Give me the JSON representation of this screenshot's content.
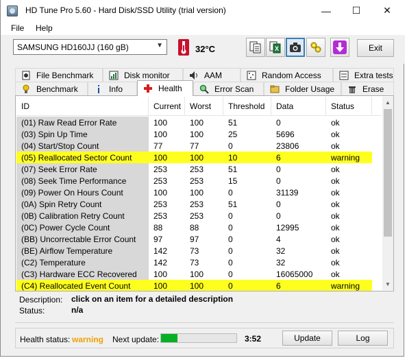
{
  "window": {
    "title": "HD Tune Pro 5.60 - Hard Disk/SSD Utility (trial version)",
    "minimize": "—",
    "maximize": "☐",
    "close": "✕"
  },
  "menu": {
    "file": "File",
    "help": "Help"
  },
  "toolbar": {
    "drive": "SAMSUNG HD160JJ (160 gB)",
    "temperature": "32°C",
    "exit_label": "Exit",
    "buttons": [
      "copy-text-icon",
      "copy-excel-icon",
      "screenshot-icon",
      "options-icon",
      "save-download-icon"
    ]
  },
  "tabs": {
    "row1": [
      "File Benchmark",
      "Disk monitor",
      "AAM",
      "Random Access",
      "Extra tests"
    ],
    "row2": [
      "Benchmark",
      "Info",
      "Health",
      "Error Scan",
      "Folder Usage",
      "Erase"
    ],
    "active": "Health"
  },
  "table": {
    "headers": [
      "ID",
      "Current",
      "Worst",
      "Threshold",
      "Data",
      "Status"
    ],
    "rows": [
      [
        "(01) Raw Read Error Rate",
        "100",
        "100",
        "51",
        "0",
        "ok"
      ],
      [
        "(03) Spin Up Time",
        "100",
        "100",
        "25",
        "5696",
        "ok"
      ],
      [
        "(04) Start/Stop Count",
        "77",
        "77",
        "0",
        "23806",
        "ok"
      ],
      [
        "(05) Reallocated Sector Count",
        "100",
        "100",
        "10",
        "6",
        "warning"
      ],
      [
        "(07) Seek Error Rate",
        "253",
        "253",
        "51",
        "0",
        "ok"
      ],
      [
        "(08) Seek Time Performance",
        "253",
        "253",
        "15",
        "0",
        "ok"
      ],
      [
        "(09) Power On Hours Count",
        "100",
        "100",
        "0",
        "31139",
        "ok"
      ],
      [
        "(0A) Spin Retry Count",
        "253",
        "253",
        "51",
        "0",
        "ok"
      ],
      [
        "(0B) Calibration Retry Count",
        "253",
        "253",
        "0",
        "0",
        "ok"
      ],
      [
        "(0C) Power Cycle Count",
        "88",
        "88",
        "0",
        "12995",
        "ok"
      ],
      [
        "(BB) Uncorrectable Error Count",
        "97",
        "97",
        "0",
        "4",
        "ok"
      ],
      [
        "(BE) Airflow Temperature",
        "142",
        "73",
        "0",
        "32",
        "ok"
      ],
      [
        "(C2) Temperature",
        "142",
        "73",
        "0",
        "32",
        "ok"
      ],
      [
        "(C3) Hardware ECC Recovered",
        "100",
        "100",
        "0",
        "16065000",
        "ok"
      ],
      [
        "(C4) Reallocated Event Count",
        "100",
        "100",
        "0",
        "6",
        "warning"
      ]
    ]
  },
  "description": {
    "label": "Description:",
    "value": "click on an item for a detailed description",
    "status_label": "Status:",
    "status_value": "n/a"
  },
  "status_bar": {
    "health_label": "Health status:",
    "health_value": "warning",
    "next_update_label": "Next update:",
    "progress_fraction": 0.22,
    "countdown": "3:52",
    "update_label": "Update",
    "log_label": "Log"
  },
  "colors": {
    "warning_row": "#ffff1f",
    "warning_text": "#f0a000",
    "progress_fill": "#06b025"
  }
}
